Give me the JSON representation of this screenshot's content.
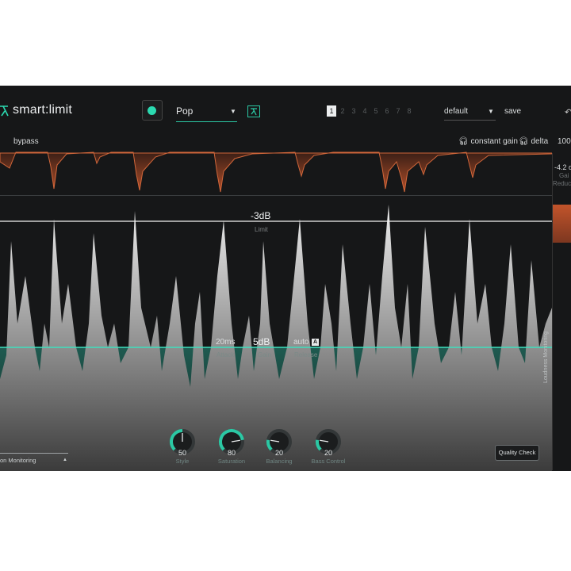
{
  "header": {
    "app_name": "smart:limit",
    "profile_label": "Pop",
    "slots": [
      "1",
      "2",
      "3",
      "4",
      "5",
      "6",
      "7",
      "8"
    ],
    "preset_label": "default",
    "save_label": "save"
  },
  "options": {
    "bypass_label": "bypass",
    "constant_gain_label": "constant gain",
    "delta_label": "delta"
  },
  "meter": {
    "top_value": "100",
    "gain_reduction_value": "-4.2 d",
    "gain_reduction_label_1": "Gai",
    "gain_reduction_label_2": "Reducti"
  },
  "graph": {
    "limit_value": "-3dB",
    "limit_label": "Limit",
    "attack_value": "20ms",
    "attack_label": "Attack",
    "gain_value": "5dB",
    "gain_label": "Gain",
    "release_value": "auto",
    "release_label": "Release",
    "release_auto_badge": "A",
    "loudness_label": "Loudness Monitoring"
  },
  "knobs": [
    {
      "label": "Style",
      "value": "50",
      "level": 0.5
    },
    {
      "label": "Saturation",
      "value": "80",
      "level": 0.8
    },
    {
      "label": "Balancing",
      "value": "20",
      "level": 0.2
    },
    {
      "label": "Bass Control",
      "value": "20",
      "level": 0.2
    }
  ],
  "footer": {
    "monitoring_label": "on Monitoring",
    "quality_check_label": "Quality Check"
  },
  "colors": {
    "accent": "#2bd9b0",
    "gain_reduction": "#c2542b",
    "waveform": "#d9d9d9",
    "background": "#161718"
  }
}
